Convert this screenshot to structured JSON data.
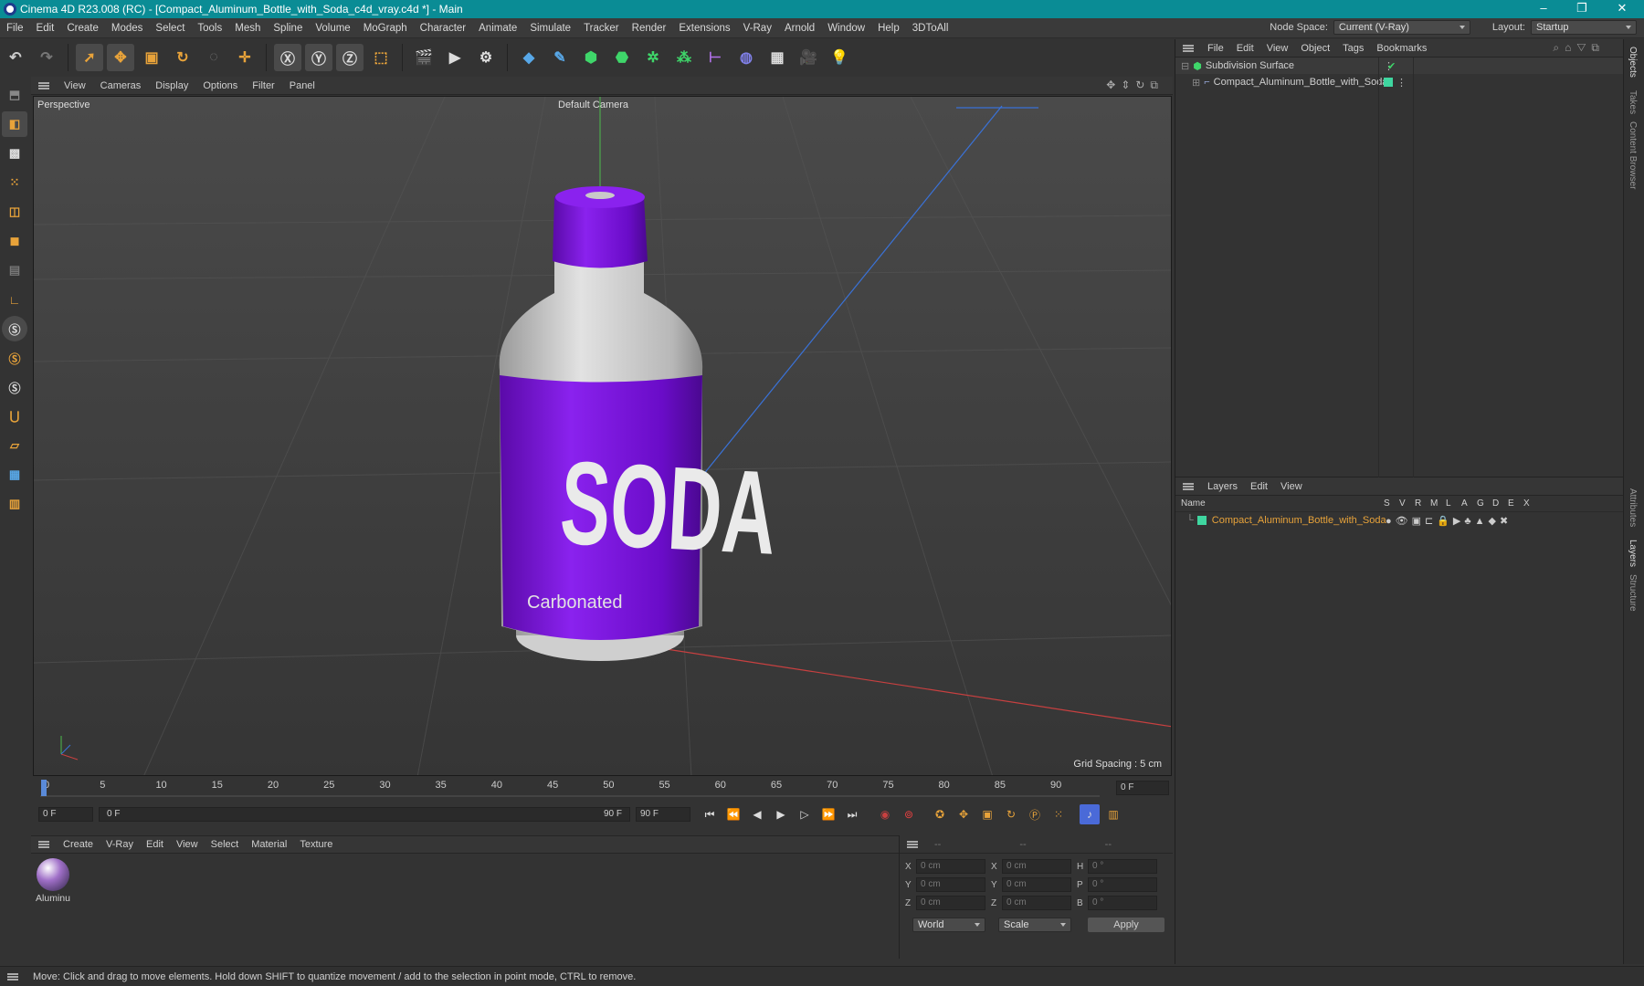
{
  "window": {
    "title": "Cinema 4D R23.008 (RC) - [Compact_Aluminum_Bottle_with_Soda_c4d_vray.c4d *] - Main",
    "minimize": "–",
    "maximize": "❐",
    "close": "✕"
  },
  "menubar": {
    "items": [
      "File",
      "Edit",
      "Create",
      "Modes",
      "Select",
      "Tools",
      "Mesh",
      "Spline",
      "Volume",
      "MoGraph",
      "Character",
      "Animate",
      "Simulate",
      "Tracker",
      "Render",
      "Extensions",
      "V-Ray",
      "Arnold",
      "Window",
      "Help",
      "3DToAll"
    ],
    "node_space_label": "Node Space:",
    "node_space_value": "Current (V-Ray)",
    "layout_label": "Layout:",
    "layout_value": "Startup"
  },
  "viewport": {
    "menu": [
      "View",
      "Cameras",
      "Display",
      "Options",
      "Filter",
      "Panel"
    ],
    "name": "Perspective",
    "camera": "Default Camera",
    "grid_spacing": "Grid Spacing : 5 cm",
    "label_main": "SODA",
    "label_sub": "Carbonated"
  },
  "timeline": {
    "ticks": [
      "0",
      "5",
      "10",
      "15",
      "20",
      "25",
      "30",
      "35",
      "40",
      "45",
      "50",
      "55",
      "60",
      "65",
      "70",
      "75",
      "80",
      "85",
      "90"
    ],
    "current_frame": "0 F",
    "start": "0 F",
    "range_start": "0 F",
    "range_end": "90 F",
    "end": "90 F"
  },
  "material_manager": {
    "menu": [
      "Create",
      "V-Ray",
      "Edit",
      "View",
      "Select",
      "Material",
      "Texture"
    ],
    "material_name": "Aluminu"
  },
  "coordinates": {
    "header": [
      "--",
      "--",
      "--"
    ],
    "rows": [
      {
        "a": "X",
        "av": "0 cm",
        "b": "X",
        "bv": "0 cm",
        "c": "H",
        "cv": "0 °"
      },
      {
        "a": "Y",
        "av": "0 cm",
        "b": "Y",
        "bv": "0 cm",
        "c": "P",
        "cv": "0 °"
      },
      {
        "a": "Z",
        "av": "0 cm",
        "b": "Z",
        "bv": "0 cm",
        "c": "B",
        "cv": "0 °"
      }
    ],
    "space": "World",
    "mode": "Scale",
    "apply": "Apply"
  },
  "objects_panel": {
    "menu": [
      "File",
      "Edit",
      "View",
      "Object",
      "Tags",
      "Bookmarks"
    ],
    "items": [
      "Subdivision Surface",
      "Compact_Aluminum_Bottle_with_Soda"
    ]
  },
  "layers_panel": {
    "menu": [
      "Layers",
      "Edit",
      "View"
    ],
    "columns": [
      "Name",
      "S",
      "V",
      "R",
      "M",
      "L",
      "A",
      "G",
      "D",
      "E",
      "X"
    ],
    "layer": "Compact_Aluminum_Bottle_with_Soda"
  },
  "right_tabs": [
    "Objects",
    "Takes",
    "Content Browser",
    "Attributes",
    "Layers",
    "Structure"
  ],
  "status": "Move: Click and drag to move elements. Hold down SHIFT to quantize movement / add to the selection in point mode, CTRL to remove.",
  "colors": {
    "titlebar": "#0a8c95",
    "accent_orange": "#e8a33a",
    "layer_green": "#3fd6a0",
    "bottle_purple": "#7a12d8"
  }
}
